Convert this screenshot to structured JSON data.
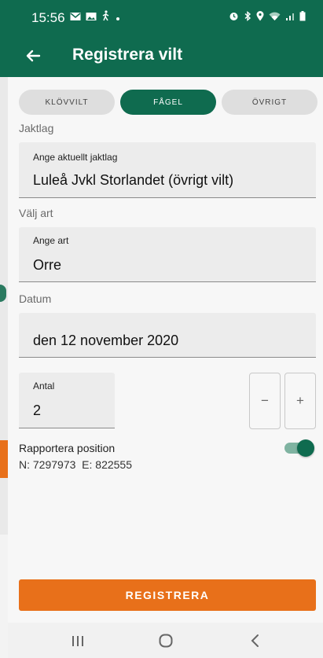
{
  "status_bar": {
    "time": "15:56",
    "left_icons": [
      "mail-icon",
      "image-icon",
      "walking-icon",
      "dot-icon"
    ],
    "right_icons": [
      "alarm-icon",
      "bluetooth-icon",
      "location-icon",
      "wifi-icon",
      "signal-icon",
      "battery-icon"
    ]
  },
  "app_bar": {
    "title": "Registrera vilt",
    "back_icon": "arrow-left-icon"
  },
  "tabs": [
    {
      "label": "KLÖVVILT",
      "active": false
    },
    {
      "label": "FÅGEL",
      "active": true
    },
    {
      "label": "ÖVRIGT",
      "active": false
    }
  ],
  "form": {
    "jaktlag_section": "Jaktlag",
    "jaktlag_label": "Ange aktuellt jaktlag",
    "jaktlag_value": "Luleå Jvkl Storlandet (övrigt vilt)",
    "art_section": "Välj art",
    "art_label": "Ange art",
    "art_value": "Orre",
    "datum_section": "Datum",
    "datum_value": "den 12 november 2020",
    "antal_label": "Antal",
    "antal_value": "2",
    "minus_label": "−",
    "plus_label": "+",
    "report_position_label": "Rapportera position",
    "report_position_on": true,
    "coordinates": "N: 7297973  E: 822555"
  },
  "register_button": "REGISTRERA",
  "nav_bar": {
    "icons": [
      "recent-apps-icon",
      "home-icon",
      "back-icon"
    ]
  },
  "colors": {
    "primary": "#0f6b4f",
    "accent": "#e8701a"
  }
}
